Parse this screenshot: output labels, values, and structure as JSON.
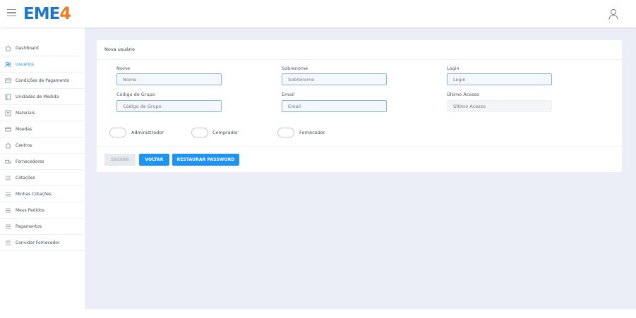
{
  "header": {
    "logo_main": "EME",
    "logo_accent": "4",
    "brand_colors": {
      "primary": "#1f75c6",
      "accent": "#f07a22"
    },
    "menu_icon": "hamburger-icon",
    "user_icon": "user-icon"
  },
  "sidebar": {
    "items": [
      {
        "label": "DashBoard",
        "icon": "home-icon",
        "active": false
      },
      {
        "label": "Usuários",
        "icon": "users-icon",
        "active": true
      },
      {
        "label": "Condições de Pagamento",
        "icon": "card-icon",
        "active": false
      },
      {
        "label": "Unidades de Medida",
        "icon": "ruler-icon",
        "active": false
      },
      {
        "label": "Materiais",
        "icon": "box-icon",
        "active": false
      },
      {
        "label": "Moedas",
        "icon": "money-icon",
        "active": false
      },
      {
        "label": "Centros",
        "icon": "home-icon",
        "active": false
      },
      {
        "label": "Fornecedores",
        "icon": "truck-icon",
        "active": false
      },
      {
        "label": "Cotações",
        "icon": "list-icon",
        "active": false
      },
      {
        "label": "Minhas Cotações",
        "icon": "list-icon",
        "active": false
      },
      {
        "label": "Meus Pedidos",
        "icon": "list-icon",
        "active": false
      },
      {
        "label": "Pagamentos",
        "icon": "list-icon",
        "active": false
      },
      {
        "label": "Convidar Fornecedor",
        "icon": "list-icon",
        "active": false
      }
    ],
    "active_color": "#1f8ff0"
  },
  "form": {
    "title": "Nova usuário",
    "fields": {
      "nome": {
        "label": "Nome",
        "placeholder": "Nome"
      },
      "sobrenome": {
        "label": "Sobrenome",
        "placeholder": "Sobrenome"
      },
      "login": {
        "label": "Login",
        "placeholder": "Login"
      },
      "codigo_grupo": {
        "label": "Código de Grupo",
        "placeholder": "Código de Grupo"
      },
      "email": {
        "label": "Email",
        "placeholder": "Email"
      },
      "ultimo_acesso": {
        "label": "Último Acesso",
        "placeholder": "Último Acesso",
        "disabled": true
      }
    },
    "toggles": [
      {
        "label": "Administrador",
        "on": false
      },
      {
        "label": "Comprador",
        "on": false
      },
      {
        "label": "Fornecedor",
        "on": false
      }
    ],
    "buttons": {
      "save": "SALVAR",
      "back": "VOLTAR",
      "reset": "RESTAURAR PASSWORD"
    },
    "button_color": "#1e94f2"
  }
}
